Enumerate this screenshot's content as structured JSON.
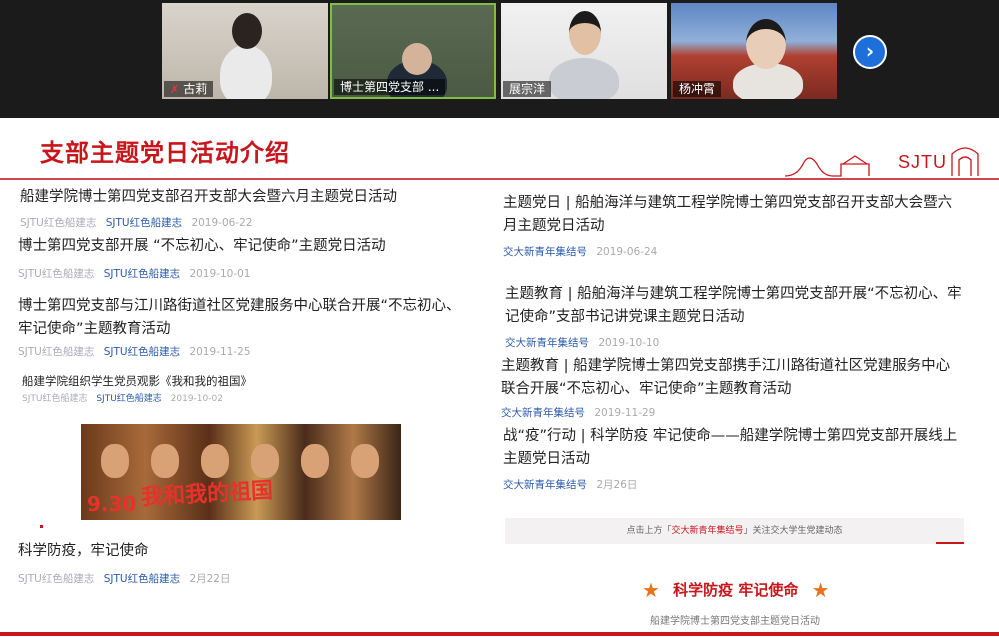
{
  "participants": [
    {
      "name": "古莉",
      "muted": true
    },
    {
      "name": "博士第四党支部 ...",
      "muted": false,
      "active": true
    },
    {
      "name": "展宗洋",
      "muted": false
    },
    {
      "name": "杨冲霄",
      "muted": false
    }
  ],
  "next_page_glyph": "›",
  "slide": {
    "title": "支部主题党日活动介绍",
    "logo_text": "SJTU"
  },
  "left_articles": [
    {
      "title": "船建学院博士第四党支部召开支部大会暨六月主题党日活动",
      "src1": "SJTU红色船建志",
      "src2": "SJTU红色船建志",
      "date": "2019-06-22"
    },
    {
      "title": "博士第四党支部开展 “不忘初心、牢记使命”主题党日活动",
      "src1": "SJTU红色船建志",
      "src2": "SJTU红色船建志",
      "date": "2019-10-01"
    },
    {
      "title": "博士第四党支部与江川路街道社区党建服务中心联合开展“不忘初心、牢记使命”主题教育活动",
      "src1": "SJTU红色船建志",
      "src2": "SJTU红色船建志",
      "date": "2019-11-25"
    },
    {
      "title": "船建学院组织学生党员观影《我和我的祖国》",
      "src1": "SJTU红色船建志",
      "src2": "SJTU红色船建志",
      "date": "2019-10-02"
    },
    {
      "title": "科学防疫，牢记使命",
      "src1": "SJTU红色船建志",
      "src2": "SJTU红色船建志",
      "date": "2月22日"
    }
  ],
  "poster": {
    "title": "我和我的祖国",
    "date": "9.30"
  },
  "right_articles": [
    {
      "title": "主题党日 | 船舶海洋与建筑工程学院博士第四党支部召开支部大会暨六月主题党日活动",
      "src": "交大新青年集结号",
      "date": "2019-06-24"
    },
    {
      "title": "主题教育 | 船舶海洋与建筑工程学院博士第四党支部开展“不忘初心、牢记使命”支部书记讲党课主题党日活动",
      "src": "交大新青年集结号",
      "date": "2019-10-10"
    },
    {
      "title": "主题教育 | 船建学院博士第四党支部携手江川路街道社区党建服务中心 联合开展“不忘初心、牢记使命”主题教育活动",
      "src": "交大新青年集结号",
      "date": "2019-11-29"
    },
    {
      "title": "战“疫”行动 | 科学防疫 牢记使命——船建学院博士第四党支部开展线上主题党日活动",
      "src": "交大新青年集结号",
      "date": "2月26日"
    }
  ],
  "banner": {
    "pre": "点击上方「",
    "highlight": "交大新青年集结号",
    "post": "」关注交大学生党建动态"
  },
  "footer": {
    "title": "科学防疫 牢记使命",
    "star": "★",
    "subtitle": "船建学院博士第四党支部主题党日活动"
  },
  "colors": {
    "brand_red": "#c8161d",
    "link_blue": "#2a5aa8",
    "star_orange": "#e8731d"
  }
}
